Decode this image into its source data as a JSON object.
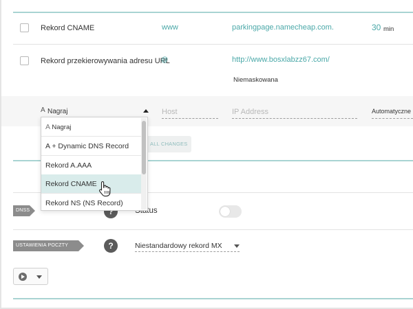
{
  "records": [
    {
      "type": "Rekord CNAME",
      "host": "www",
      "value": "parkingpage.namecheap.com.",
      "ttl_value": "30",
      "ttl_unit": "min"
    },
    {
      "type": "Rekord przekierowywania adresu URL",
      "type_suffix": "@",
      "value": "http://www.bosxlabzz67.com/",
      "note": "Niemaskowana"
    }
  ],
  "new_record": {
    "type_prefix": "A",
    "type_value": "Nagraj",
    "host_placeholder": "Host",
    "ip_placeholder": "IP Address",
    "ttl_value": "Automatyczne"
  },
  "save_all_label": "ALL CHANGES",
  "type_dropdown": {
    "options": [
      {
        "prefix": "A",
        "label": "Nagraj"
      },
      {
        "label": "A + Dynamic DNS Record"
      },
      {
        "label": "Rekord A.AAA"
      },
      {
        "label": "Rekord CNAME",
        "selected": true
      },
      {
        "label": "Rekord NS (NS Record)"
      }
    ]
  },
  "dnssec": {
    "tag": "DNSSEC",
    "help": "?",
    "status_label": "Status",
    "enabled": false
  },
  "mail_settings": {
    "tag": "USTAWIENIA POCZTY",
    "help": "?",
    "value": "Niestandardowy rekord MX"
  },
  "colors": {
    "accent_teal": "#4aa8a8",
    "divider_teal": "#a8d3d2",
    "selected_bg": "#d9eceb",
    "tag_grey": "#8c8c8c"
  },
  "icons": {
    "play": "play-circle-icon",
    "caret": "chevron-down-icon",
    "cursor": "hand-pointer-icon"
  }
}
